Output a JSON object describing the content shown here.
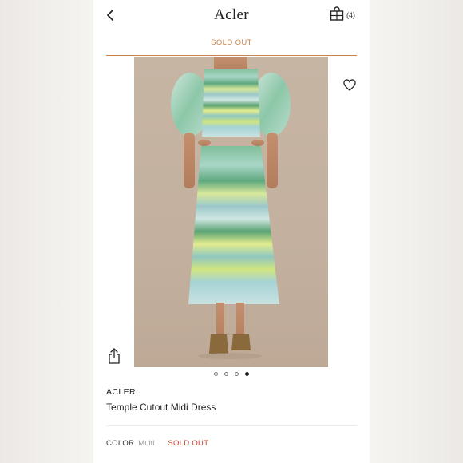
{
  "header": {
    "brand": "Acler",
    "bag_count": "(4)"
  },
  "banner": {
    "status": "SOLD OUT"
  },
  "carousel": {
    "total": 4,
    "active_index": 3
  },
  "product": {
    "brand": "ACLER",
    "name": "Temple Cutout Midi Dress"
  },
  "color": {
    "label": "COLOR",
    "value": "Multi",
    "status": "SOLD OUT"
  },
  "colors": {
    "accent": "#c9834b",
    "sold_out_red": "#d23b2c",
    "text": "#222222"
  },
  "icons": {
    "back": "chevron-left-icon",
    "bag": "shopping-bag-icon",
    "favorite": "heart-icon",
    "share": "share-icon"
  }
}
